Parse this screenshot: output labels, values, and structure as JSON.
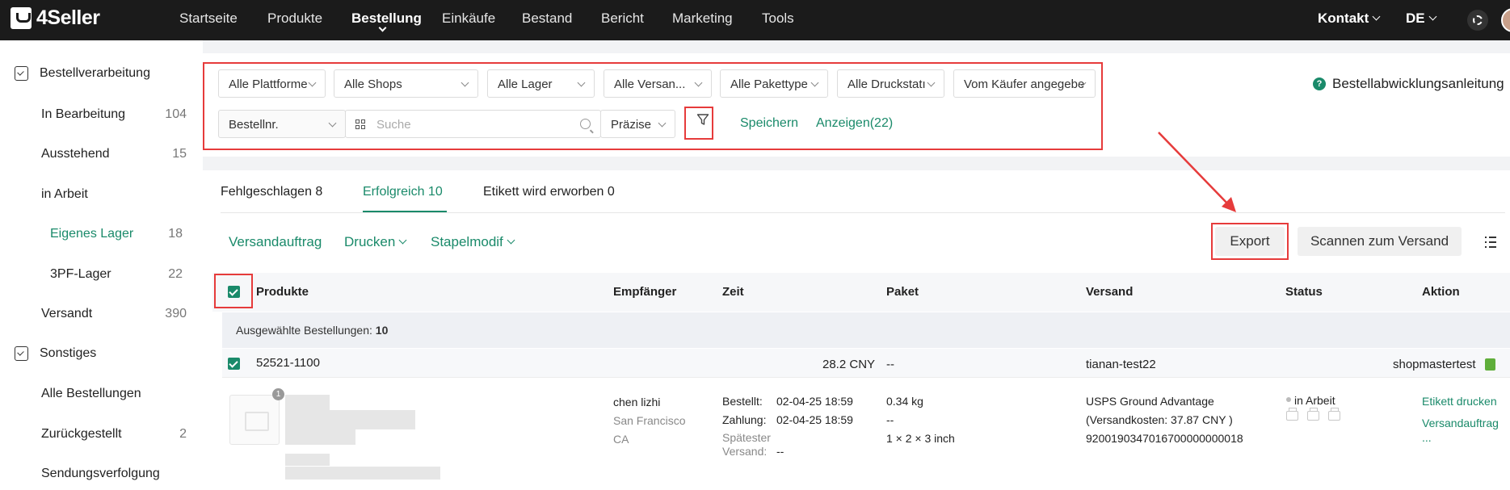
{
  "app": {
    "logo_text": "4Seller"
  },
  "nav": {
    "items": [
      "Startseite",
      "Produkte",
      "Bestellung",
      "Einkäufe",
      "Bestand",
      "Bericht",
      "Marketing",
      "Tools"
    ],
    "active": "Bestellung",
    "contact": "Kontakt",
    "language": "DE"
  },
  "sidebar": {
    "group1": "Bestellverarbeitung",
    "items": [
      {
        "label": "In Bearbeitung",
        "count": "104"
      },
      {
        "label": "Ausstehend",
        "count": "15"
      },
      {
        "label": "in Arbeit",
        "count": ""
      },
      {
        "label": "Eigenes Lager",
        "count": "18"
      },
      {
        "label": "3PF-Lager",
        "count": "22"
      },
      {
        "label": "Versandt",
        "count": "390"
      }
    ],
    "group2": "Sonstiges",
    "items2": [
      {
        "label": "Alle Bestellungen",
        "count": ""
      },
      {
        "label": "Zurückgestellt",
        "count": "2"
      },
      {
        "label": "Sendungsverfolgung",
        "count": ""
      }
    ]
  },
  "filters": {
    "selects": [
      "Alle Plattforme",
      "Alle Shops",
      "Alle Lager",
      "Alle Versan...",
      "Alle Pakettype",
      "Alle Druckstatı",
      "Vom Käufer angegebe"
    ],
    "search_field": "Bestellnr.",
    "search_placeholder": "Suche",
    "precision": "Präzise",
    "save": "Speichern",
    "show": "Anzeigen(22)",
    "guide": "Bestellabwicklungsanleitung"
  },
  "tabs": [
    "Fehlgeschlagen 8",
    "Erfolgreich 10",
    "Etikett wird erworben 0"
  ],
  "actions": {
    "ship_order": "Versandauftrag",
    "print": "Drucken",
    "batch": "Stapelmodif",
    "export": "Export",
    "scan": "Scannen zum Versand"
  },
  "table": {
    "headers": [
      "Produkte",
      "Empfänger",
      "Zeit",
      "Paket",
      "Versand",
      "Status",
      "Aktion"
    ],
    "selected_label": "Ausgewählte Bestellungen:",
    "selected_count": "10",
    "order": {
      "id": "52521-1100",
      "amount": "28.2 CNY",
      "package_dash": "--",
      "store": "tianan-test22",
      "shop": "shopmastertest",
      "image_badge": "1",
      "recipient_name": "chen lizhi",
      "recipient_city": "San Francisco",
      "recipient_state": "CA",
      "time_ordered_label": "Bestellt:",
      "time_ordered": "02-04-25 18:59",
      "time_paid_label": "Zahlung:",
      "time_paid": "02-04-25 18:59",
      "time_latest_label1": "Spätester",
      "time_latest_label2": "Versand:",
      "time_latest": "--",
      "weight": "0.34 kg",
      "weight_dash": "--",
      "dimensions": "1 × 2 × 3 inch",
      "carrier": "USPS Ground Advantage",
      "shipping_cost": "(Versandkosten: 37.87 CNY )",
      "tracking": "9200190347016700000000018",
      "status": "in Arbeit",
      "action_label": "Etikett drucken",
      "action_ship": "Versandauftrag",
      "action_more": "..."
    }
  },
  "colors": {
    "accent": "#1a8a6a",
    "highlight": "#e63b3b",
    "nav_bg": "#1b1b1b"
  }
}
